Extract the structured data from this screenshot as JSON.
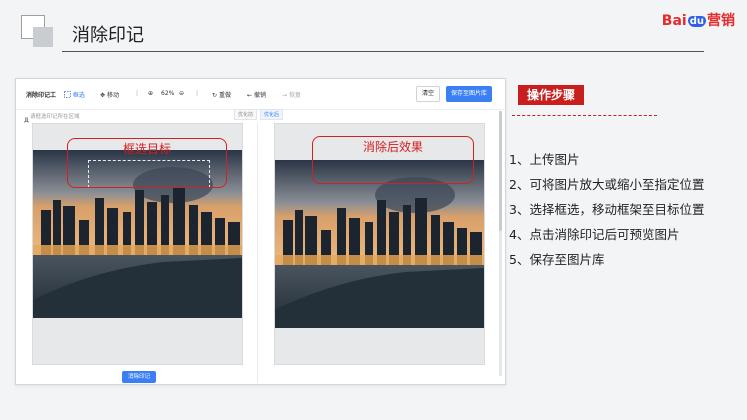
{
  "header": {
    "title": "消除印记",
    "logo": {
      "bai": "Bai",
      "du": "du",
      "brand": "营销"
    }
  },
  "toolbar": {
    "tool_name": "消除印记工",
    "select": "框选",
    "move": "移动",
    "zoom_value": "62%",
    "reset": "重做",
    "undo": "撤销",
    "redo": "恢复",
    "clear": "清空",
    "save": "保存至图片库"
  },
  "workspace": {
    "side_label": "具",
    "hint": "请框选印记所在区域",
    "tab_before": "优化前",
    "tab_after": "优化后",
    "erase_button": "消除印记"
  },
  "callouts": {
    "select_target": "框选目标",
    "after_effect": "消除后效果"
  },
  "steps": {
    "title": "操作步骤",
    "items": [
      "1、上传图片",
      "2、可将图片放大或缩小至指定位置",
      "3、选择框选，移动框架至目标位置",
      "4、点击消除印记后可预览图片",
      "5、保存至图片库"
    ]
  },
  "colors": {
    "accent": "#3b7ff5",
    "highlight": "#c81e1e"
  }
}
